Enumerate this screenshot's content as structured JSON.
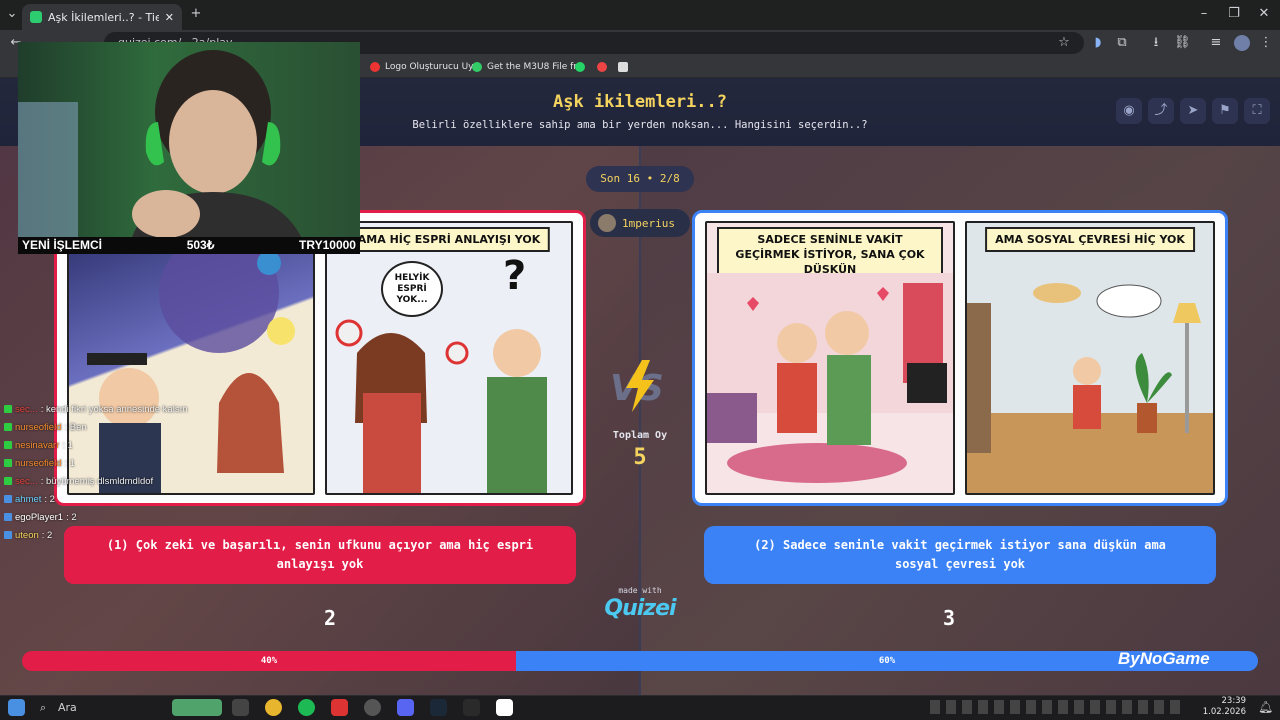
{
  "browser": {
    "tab_title": "Aşk İkilemleri..? - Tier List, Kör S",
    "url": "quizei.com/...2a/play",
    "bookmarks": [
      "Logo Oluşturucu Uy...",
      "Get the M3U8 File fr..."
    ]
  },
  "page": {
    "title": "Aşk ikilemleri..?",
    "subtitle": "Belirli özelliklere sahip ama bir yerden noksan... Hangisini seçerdin..?",
    "round": "Son 16 • 2/8",
    "username": "1mperius",
    "total_votes_label": "Toplam Oy",
    "total_votes": "5",
    "made_with": "made with",
    "brand": "Quizei",
    "sponsor": "ByNoGame"
  },
  "options": [
    {
      "label": "(1) Çok zeki ve başarılı, senin ufkunu açıyor ama hiç espri anlayışı yok",
      "panel_captions": [
        "",
        "AMA HİÇ ESPRİ ANLAYIŞI YOK"
      ],
      "speech": "HELYİK ESPRİ YOK...",
      "votes": "2",
      "percent": "40%",
      "fraction": 0.4,
      "color": "#e11d48"
    },
    {
      "label": "(2) Sadece seninle vakit geçirmek istiyor sana düşkün ama sosyal çevresi yok",
      "panel_captions": [
        "SADECE SENİNLE VAKİT GEÇİRMEK İSTİYOR, SANA ÇOK DÜŞKÜN",
        "AMA SOSYAL ÇEVRESİ HİÇ YOK"
      ],
      "votes": "3",
      "percent": "60%",
      "fraction": 0.6,
      "color": "#3b82f6"
    }
  ],
  "webcam": {
    "strip": [
      "YENİ İŞLEMCİ",
      "503₺",
      "TRY10000"
    ]
  },
  "chat": [
    {
      "user": "sec...",
      "msg": ": kendi fikri yoksa annesinde kalsın",
      "color": "#e0443b"
    },
    {
      "user": "nurseofield",
      "msg": ": Ben",
      "color": "#f08a2c"
    },
    {
      "user": "nesinavarr",
      "msg": ": 1",
      "color": "#f08a2c"
    },
    {
      "user": "nurseofield",
      "msg": ": 1",
      "color": "#f08a2c"
    },
    {
      "user": "sec...",
      "msg": ": büyümemiş dlsmldmdldof",
      "color": "#e0443b"
    },
    {
      "user": "ahmet",
      "msg": ": 2",
      "color": "#6ad0ff"
    },
    {
      "user": "egoPlayer1",
      "msg": ": 2",
      "color": "#ffffff"
    },
    {
      "user": "uteon",
      "msg": ": 2",
      "color": "#f4d35e"
    }
  ],
  "taskbar": {
    "search": "Ara",
    "time": "23:39",
    "date": "1.02.2026"
  }
}
